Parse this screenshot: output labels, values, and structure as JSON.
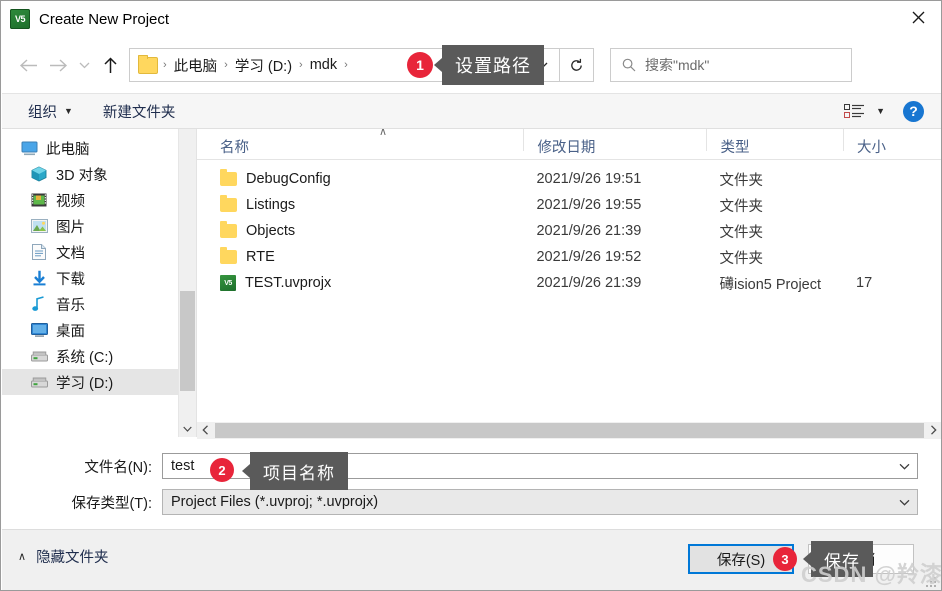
{
  "window": {
    "title": "Create New Project",
    "app_icon": "uvision5-icon",
    "close_label": "✕"
  },
  "nav": {
    "back_icon": "arrow-left-icon",
    "forward_icon": "arrow-right-icon",
    "history_icon": "chevron-down-icon",
    "up_icon": "arrow-up-icon",
    "breadcrumbs": [
      "此电脑",
      "学习 (D:)",
      "mdk"
    ],
    "separator": "›",
    "dropdown_icon": "chevron-down-icon",
    "refresh_icon": "refresh-icon"
  },
  "search": {
    "placeholder": "搜索\"mdk\"",
    "icon": "search-icon"
  },
  "toolbar": {
    "organize": "组织",
    "organize_caret": "▼",
    "new_folder": "新建文件夹",
    "view_icon": "view-options-icon",
    "view_caret": "▼",
    "help_label": "?",
    "help_color": "#1876d1"
  },
  "sidebar": {
    "items": [
      {
        "label": "此电脑",
        "icon": "computer-icon",
        "selected": false,
        "root": true
      },
      {
        "label": "3D 对象",
        "icon": "3d-objects-icon",
        "selected": false,
        "root": false
      },
      {
        "label": "视频",
        "icon": "videos-icon",
        "selected": false,
        "root": false
      },
      {
        "label": "图片",
        "icon": "pictures-icon",
        "selected": false,
        "root": false
      },
      {
        "label": "文档",
        "icon": "documents-icon",
        "selected": false,
        "root": false
      },
      {
        "label": "下载",
        "icon": "downloads-icon",
        "selected": false,
        "root": false
      },
      {
        "label": "音乐",
        "icon": "music-icon",
        "selected": false,
        "root": false
      },
      {
        "label": "桌面",
        "icon": "desktop-icon",
        "selected": false,
        "root": false
      },
      {
        "label": "系统 (C:)",
        "icon": "drive-icon",
        "selected": false,
        "root": false
      },
      {
        "label": "学习 (D:)",
        "icon": "drive-icon",
        "selected": true,
        "root": false
      }
    ],
    "scroll_up_icon": "chevron-up-icon",
    "scroll_down_icon": "chevron-down-icon"
  },
  "filelist": {
    "columns": [
      "名称",
      "修改日期",
      "类型",
      "大小"
    ],
    "sort_indicator": "∧",
    "rows": [
      {
        "name": "DebugConfig",
        "date": "2021/9/26 19:51",
        "type": "文件夹",
        "size": "",
        "icon": "folder-icon"
      },
      {
        "name": "Listings",
        "date": "2021/9/26 19:55",
        "type": "文件夹",
        "size": "",
        "icon": "folder-icon"
      },
      {
        "name": "Objects",
        "date": "2021/9/26 21:39",
        "type": "文件夹",
        "size": "",
        "icon": "folder-icon"
      },
      {
        "name": "RTE",
        "date": "2021/9/26 19:52",
        "type": "文件夹",
        "size": "",
        "icon": "folder-icon"
      },
      {
        "name": "TEST.uvprojx",
        "date": "2021/9/26 21:39",
        "type": "礡ision5 Project",
        "size": "17",
        "icon": "uvision5-icon"
      }
    ],
    "hscroll_left_icon": "chevron-left-icon",
    "hscroll_right_icon": "chevron-right-icon"
  },
  "form": {
    "filename_label": "文件名(N):",
    "filename_value": "test",
    "savetype_label": "保存类型(T):",
    "savetype_value": "Project Files (*.uvproj; *.uvprojx)",
    "dropdown_icon": "chevron-down-icon"
  },
  "footer": {
    "hide_folders": "隐藏文件夹",
    "hide_folders_caret": "∧",
    "save_label": "保存(S)",
    "cancel_label": "取消",
    "save_focus_color": "#0078d7"
  },
  "annotations": {
    "badge_1": "1",
    "tip_1": "设置路径",
    "badge_2": "2",
    "tip_2": "项目名称",
    "badge_3": "3",
    "tip_3": "保存",
    "badge_color": "#e8253a",
    "tip_color": "#5a5a5a"
  },
  "watermark": {
    "text": "CSDN @羚漆"
  }
}
